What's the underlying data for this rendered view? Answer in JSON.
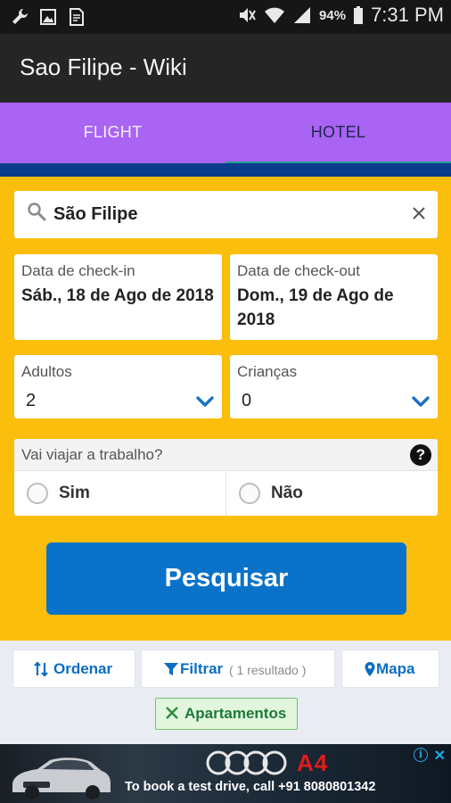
{
  "status_bar": {
    "battery": "94%",
    "time": "7:31 PM",
    "left_icons": [
      "wrench-icon",
      "image-icon",
      "document-icon"
    ],
    "right_icons": [
      "mute-icon",
      "wifi-icon",
      "signal-icon",
      "battery-icon"
    ]
  },
  "app_bar": {
    "title": "Sao Filipe - Wiki"
  },
  "tabs": [
    {
      "label": "FLIGHT",
      "active": false
    },
    {
      "label": "HOTEL",
      "active": true
    }
  ],
  "search": {
    "destination": "São Filipe",
    "clear_icon": "close-icon"
  },
  "checkin": {
    "label": "Data de check-in",
    "value": "Sáb., 18 de Ago de 2018"
  },
  "checkout": {
    "label": "Data de check-out",
    "value": "Dom., 19 de Ago de 2018"
  },
  "adults": {
    "label": "Adultos",
    "value": "2"
  },
  "children": {
    "label": "Crianças",
    "value": "0"
  },
  "business_trip": {
    "question": "Vai viajar a trabalho?",
    "help": "?",
    "options": [
      "Sim",
      "Não"
    ]
  },
  "search_button": {
    "label": "Pesquisar"
  },
  "results_bar": {
    "sort_label": "Ordenar",
    "filter_label": "Filtrar",
    "result_count": "( 1 resultado )",
    "map_label": "Mapa",
    "active_filter": "Apartamentos"
  },
  "ad": {
    "model": "A4",
    "text": "To book a test drive, call +91 8080801342"
  },
  "colors": {
    "status_bar": "#161616",
    "app_bar": "#252525",
    "tabs": "#a964f3",
    "tab_indicator": "#1e9f95",
    "band": "#093c8a",
    "form_background": "#fbbe0d",
    "primary_button": "#0a73c9",
    "link": "#0a6ec3",
    "chip_background": "#e1f6dc"
  }
}
